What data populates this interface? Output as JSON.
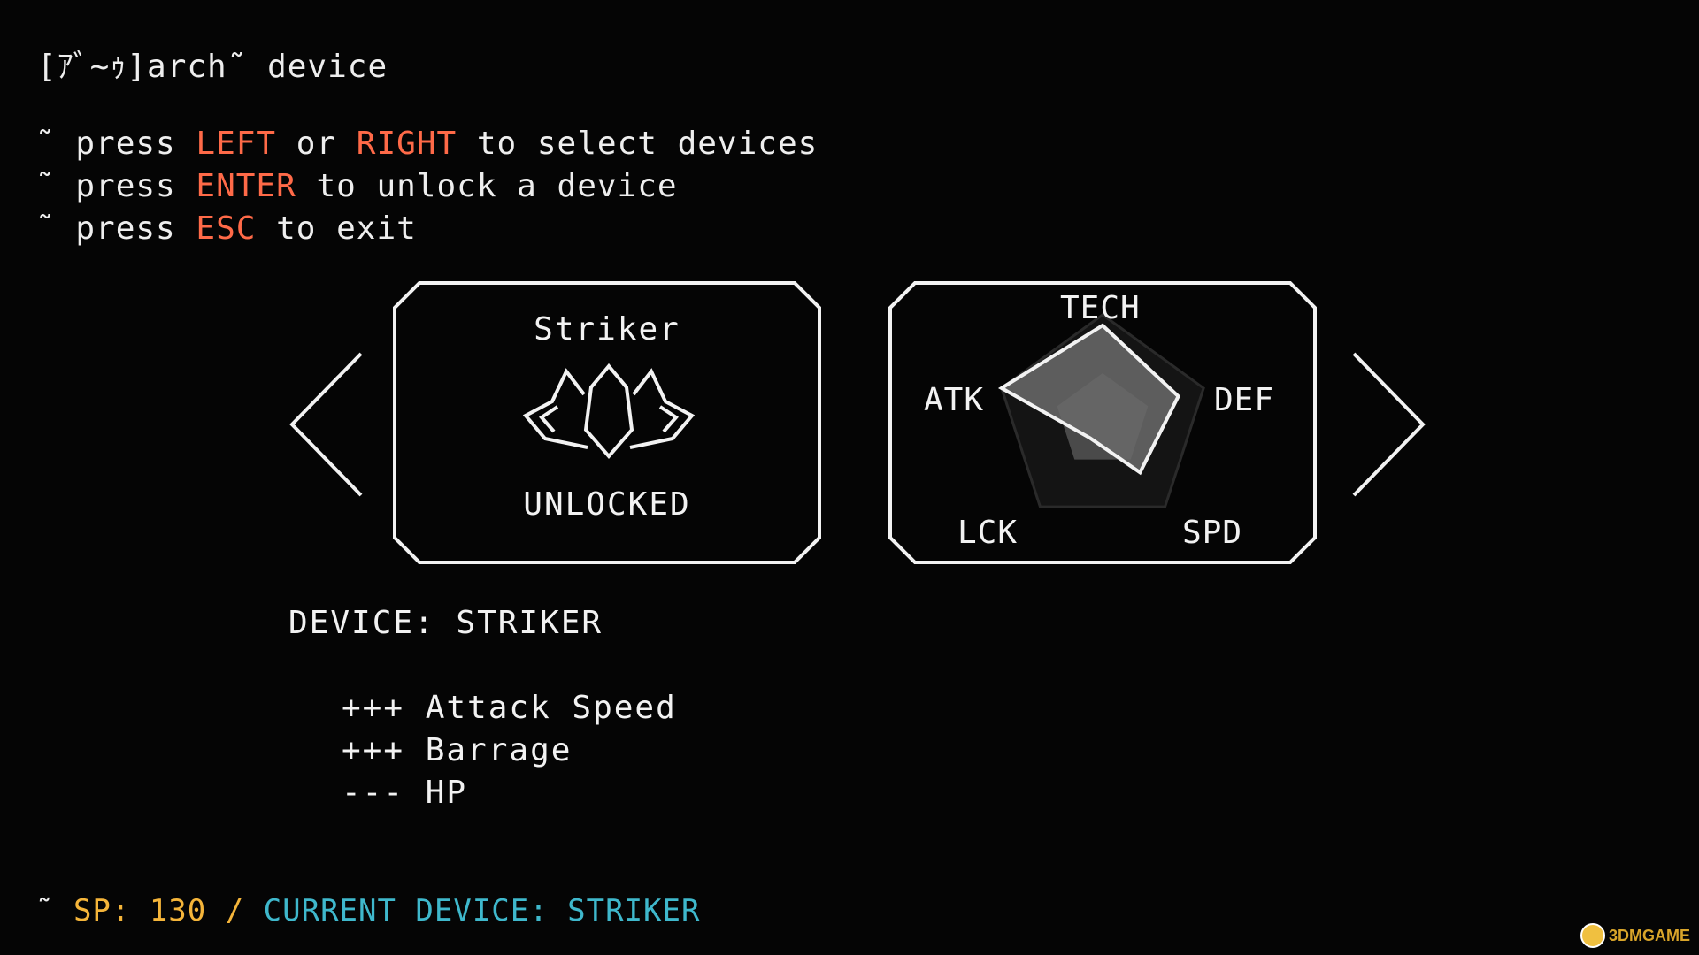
{
  "header": {
    "title_glitch": "[ｱﾞ~ｩ]",
    "title_rest": "arch˜ device"
  },
  "instructions": [
    {
      "prefix": "˜ press ",
      "key": "LEFT",
      "middle": " or ",
      "key2": "RIGHT",
      "suffix": " to select devices"
    },
    {
      "prefix": "˜ press ",
      "key": "ENTER",
      "suffix": " to unlock a device"
    },
    {
      "prefix": "˜ press ",
      "key": "ESC",
      "suffix": " to exit"
    }
  ],
  "device_card": {
    "name": "Striker",
    "status": "UNLOCKED"
  },
  "stats": {
    "labels": {
      "tech": "TECH",
      "atk": "ATK",
      "def": "DEF",
      "lck": "LCK",
      "spd": "SPD"
    },
    "values": {
      "tech": 0.9,
      "def": 0.75,
      "spd": 0.6,
      "lck": 0.2,
      "atk": 1.0
    }
  },
  "details": {
    "device_line": "DEVICE: STRIKER",
    "traits": [
      "+++ Attack Speed",
      "+++ Barrage",
      "--- HP"
    ]
  },
  "footer": {
    "tilde": "˜ ",
    "sp": "SP: 130 / ",
    "current": "CURRENT DEVICE: STRIKER"
  },
  "colors": {
    "background": "#050505",
    "text": "#eeeeee",
    "key_highlight": "#ff6a48",
    "sp": "#f5b53a",
    "current_device": "#3fb8cc",
    "radar_fill": "#6a6a6a"
  },
  "icons": [
    "arrow-left-icon",
    "arrow-right-icon",
    "striker-ship-icon",
    "stats-radar-chart"
  ],
  "watermark": "3DMGAME"
}
